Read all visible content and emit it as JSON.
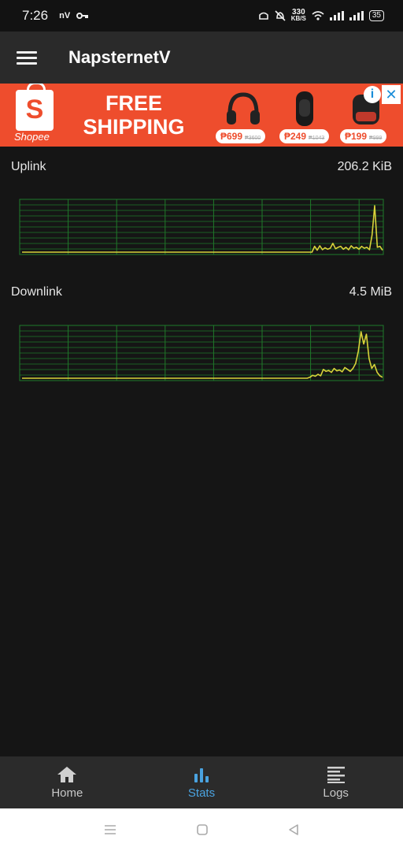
{
  "status_bar": {
    "time": "7:26",
    "carrier": "nV",
    "speed_value": "330",
    "speed_unit": "KB/S",
    "battery": "35"
  },
  "app_bar": {
    "title": "NapsternetV",
    "menu_icon": "hamburger-menu-icon"
  },
  "ad": {
    "brand": "Shopee",
    "headline_line1": "FREE",
    "headline_line2": "SHIPPING",
    "prices": [
      {
        "price": "₱699",
        "old": "₱3600"
      },
      {
        "price": "₱249",
        "old": "₱1043"
      },
      {
        "price": "₱199",
        "old": "₱999"
      }
    ],
    "info_icon": "info-icon",
    "close_icon": "close-icon"
  },
  "stats": {
    "uplink": {
      "label": "Uplink",
      "value": "206.2 KiB"
    },
    "downlink": {
      "label": "Downlink",
      "value": "4.5 MiB"
    }
  },
  "colors": {
    "grid": "#1f7a2a",
    "trace": "#d8d23a",
    "active_tab": "#4aa3e0",
    "ad_background": "#ee4d2d"
  },
  "chart_data": [
    {
      "type": "line",
      "title": "Uplink",
      "grid": true,
      "series": [
        {
          "values": [
            0,
            0,
            0,
            0,
            0,
            0,
            0,
            0,
            0,
            0,
            0,
            0,
            0,
            0,
            0,
            0,
            0,
            0,
            0,
            0,
            0,
            0,
            0,
            0,
            0,
            0,
            0,
            0,
            0,
            0,
            0,
            0,
            0,
            0,
            0,
            0,
            0,
            0,
            0,
            0,
            0,
            0,
            0,
            0,
            0,
            0,
            0,
            0,
            0,
            0,
            0,
            0,
            0,
            0,
            0,
            0,
            0,
            0,
            0,
            0,
            0,
            0,
            0,
            0,
            0,
            0,
            0,
            0,
            0,
            0,
            0,
            0,
            0,
            0,
            0,
            0,
            0,
            0,
            0,
            0,
            0,
            0,
            0,
            0,
            0,
            0,
            0,
            0,
            0,
            0,
            0,
            0,
            0,
            0,
            0,
            0,
            0,
            0,
            0,
            0,
            0,
            0,
            0,
            0,
            0,
            0,
            0,
            0,
            0,
            0,
            0,
            0,
            0.12,
            0.04,
            0.13,
            0.05,
            0.09,
            0.06,
            0.08,
            0.18,
            0.07,
            0.1,
            0.12,
            0.06,
            0.1,
            0.05,
            0.13,
            0.08,
            0.1,
            0.06,
            0.12,
            0.08,
            0.1,
            0.05,
            0.35,
            0.95,
            0.1,
            0.12,
            0.04
          ]
        }
      ]
    },
    {
      "type": "line",
      "title": "Downlink",
      "grid": true,
      "series": [
        {
          "values": [
            0,
            0,
            0,
            0,
            0,
            0,
            0,
            0,
            0,
            0,
            0,
            0,
            0,
            0,
            0,
            0,
            0,
            0,
            0,
            0,
            0,
            0,
            0,
            0,
            0,
            0,
            0,
            0,
            0,
            0,
            0,
            0,
            0,
            0,
            0,
            0,
            0,
            0,
            0,
            0,
            0,
            0,
            0,
            0,
            0,
            0,
            0,
            0,
            0,
            0,
            0,
            0,
            0,
            0,
            0,
            0,
            0,
            0,
            0,
            0,
            0,
            0,
            0,
            0,
            0,
            0,
            0,
            0,
            0,
            0,
            0,
            0,
            0,
            0,
            0,
            0,
            0,
            0,
            0,
            0,
            0,
            0,
            0,
            0,
            0,
            0,
            0,
            0,
            0,
            0,
            0,
            0,
            0,
            0,
            0,
            0,
            0,
            0,
            0,
            0,
            0,
            0,
            0,
            0,
            0,
            0,
            0,
            0.02,
            0.06,
            0.04,
            0.08,
            0.05,
            0.18,
            0.14,
            0.16,
            0.12,
            0.2,
            0.15,
            0.17,
            0.13,
            0.22,
            0.18,
            0.14,
            0.2,
            0.3,
            0.55,
            0.95,
            0.7,
            0.9,
            0.4,
            0.2,
            0.28,
            0.12,
            0.05,
            0.02
          ]
        }
      ]
    }
  ],
  "bottom_nav": [
    {
      "label": "Home",
      "icon": "home-icon",
      "active": false
    },
    {
      "label": "Stats",
      "icon": "stats-icon",
      "active": true
    },
    {
      "label": "Logs",
      "icon": "logs-icon",
      "active": false
    }
  ],
  "system_nav": {
    "recents_icon": "recents-icon",
    "home_icon": "system-home-icon",
    "back_icon": "back-icon"
  }
}
